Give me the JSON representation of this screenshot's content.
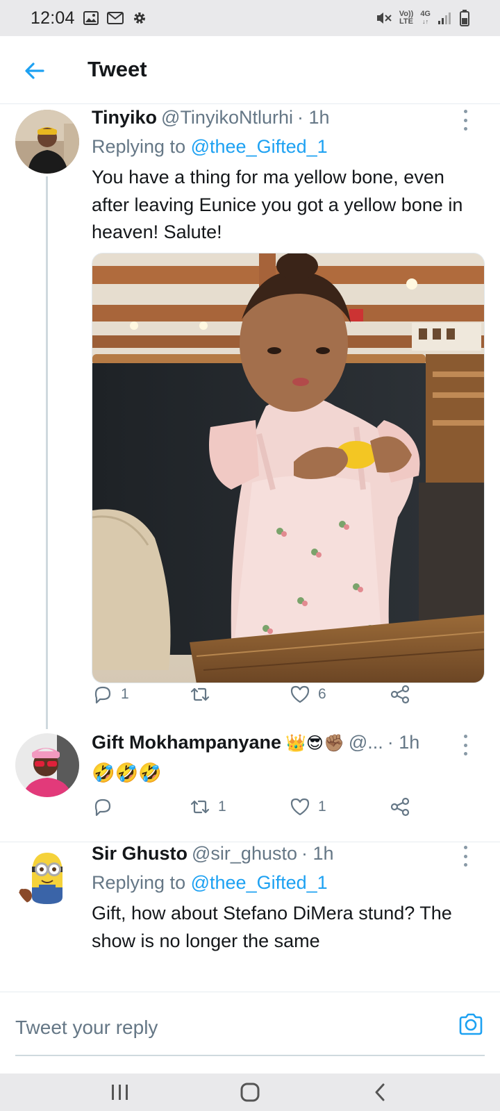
{
  "status_bar": {
    "time": "12:04",
    "left_icons": [
      "image-icon",
      "gmail-icon",
      "gear-icon"
    ],
    "volte": "Vo))",
    "lte": "LTE",
    "network": "4G",
    "right_icons": [
      "mute-icon",
      "signal-icon",
      "battery-icon"
    ]
  },
  "header": {
    "title": "Tweet",
    "back_icon": "arrow-left-icon"
  },
  "tweets": [
    {
      "name": "Tinyiko",
      "handle": "@TinyikoNtlurhi",
      "time": "· 1h",
      "replying_prefix": "Replying to",
      "replying_to": "@thee_Gifted_1",
      "text": "You have a thing for ma yellow bone, even after leaving Eunice you got a yellow bone in heaven! Salute!",
      "reply_count": "1",
      "retweet_count": "",
      "like_count": "6"
    },
    {
      "name": "Gift Mokhampanyane",
      "name_emoji": "👑😎✊🏽",
      "handle": "@...",
      "time": "· 1h",
      "text": "🤣🤣🤣",
      "reply_count": "",
      "retweet_count": "1",
      "like_count": "1"
    },
    {
      "name": "Sir Ghusto",
      "handle": "@sir_ghusto",
      "time": "· 1h",
      "replying_prefix": "Replying to",
      "replying_to": "@thee_Gifted_1",
      "text": "Gift, how about Stefano DiMera stund? The show is no longer the same"
    }
  ],
  "reply_bar": {
    "placeholder": "Tweet your reply",
    "camera_icon": "camera-icon"
  },
  "nav_bar": {
    "icons": [
      "recents-icon",
      "home-icon",
      "back-icon"
    ]
  },
  "colors": {
    "accent": "#1da1f2",
    "secondary_text": "#657786",
    "primary_text": "#14171a",
    "status_bar_bg": "#e9e9eb"
  }
}
